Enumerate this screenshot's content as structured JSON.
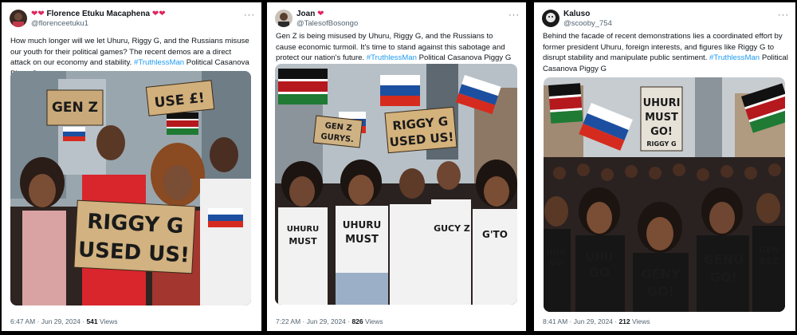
{
  "tweets": [
    {
      "display_name": "Florence Etuku Macaphena",
      "handle": "@florenceetuku1",
      "text_main": "How much longer will we let Uhuru, Riggy G, and the Russians misuse our youth for their political games? The recent demos are a direct attack on our economy and stability. ",
      "hashtag": "#TruthlessMan",
      "text_tail": " Political Casanova Piggy G",
      "time": "6:47 AM · Jun 29, 2024 · ",
      "views_count": "541",
      "views_label": " Views",
      "image_signs": [
        "GEN Z",
        "USE £!",
        "RIGGY G",
        "USED US!"
      ]
    },
    {
      "display_name": "Joan",
      "handle": "@TalesofBosongo",
      "text_main": "Gen Z is being misused by Uhuru, Riggy G, and the Russians to cause economic turmoil. It's time to stand against this sabotage and protect our nation's future. ",
      "hashtag": "#TruthlessMan",
      "text_tail": " Political Casanova Piggy G",
      "time": "7:22 AM · Jun 29, 2024 · ",
      "views_count": "826",
      "views_label": " Views",
      "image_signs": [
        "RIGGY G",
        "USED US!",
        "GEN Z",
        "GURYS.",
        "UHURU",
        "MUST",
        "UHURU",
        "MUST",
        "GUCY Z",
        "G'TO"
      ]
    },
    {
      "display_name": "Kaluso",
      "handle": "@scooby_754",
      "text_main": "Behind the facade of recent demonstrations lies a coordinated effort by former president Uhuru, foreign interests, and figures like Riggy G to disrupt stability and manipulate public sentiment. ",
      "hashtag": "#TruthlessMan",
      "text_tail": " Political Casanova Piggy G",
      "time": "8:41 AM · Jun 29, 2024 · ",
      "views_count": "212",
      "views_label": " Views",
      "image_signs": [
        "UHURI",
        "MUST",
        "GO!",
        "RIGGY G",
        "UHU",
        "GO",
        "GENY",
        "GO!",
        "GENU",
        "GO!",
        "GEN",
        "ESZ"
      ]
    }
  ],
  "ui": {
    "more_icon": "more-icon",
    "heart_icon": "heart-icon"
  },
  "colors": {
    "hashtag": "#1d9bf0",
    "muted": "#536471",
    "heart": "#e0245e"
  }
}
